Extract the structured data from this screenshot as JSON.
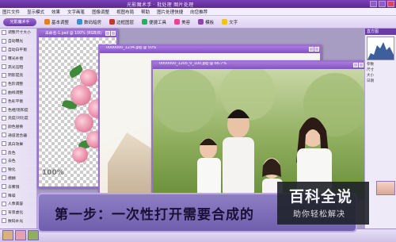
{
  "window": {
    "title": "光影魔术手 · 批处理  图片处理"
  },
  "menubar": {
    "items": [
      "图片文件",
      "显示模式",
      "效果",
      "文字画笔",
      "图像调整",
      "视图布局",
      "帮助",
      "图片处理快捷",
      "向您推荐"
    ]
  },
  "toolbar": {
    "logo": "光影魔术手",
    "items": [
      "基本调整",
      "数码暗房",
      "边框图层",
      "便捷工具",
      "美容",
      "模板",
      "文字"
    ]
  },
  "sidebar": {
    "items": [
      "调整尺寸大小",
      "自动曝光",
      "自动白平衡",
      "曝光补偿",
      "高光压暗",
      "阴影提亮",
      "色阶调整",
      "曲线调整",
      "色彩平衡",
      "色相/饱和度",
      "亮度/对比度",
      "颜色替换",
      "通道混合器",
      "黑白效果",
      "反色",
      "去色",
      "锐化",
      "模糊",
      "去雾镜",
      "降噪",
      "人像美容",
      "背景虚化",
      "数码补光"
    ]
  },
  "right_panel": {
    "header": "直方图",
    "rows": [
      "参数",
      "尺寸",
      "大小",
      "日期"
    ]
  },
  "windows": [
    {
      "title": "未命名-1.psd @ 100% (RGB/8)",
      "zoom": "100%"
    },
    {
      "title": "0000000_1234.jpg @ 50%"
    },
    {
      "title": "0000000_1205_0_100.jpg @ 66.7%"
    }
  ],
  "banner": {
    "text": "第一步：一次性打开需要合成的"
  },
  "watermark": {
    "line1": "百科全说",
    "line2": "助你轻松解决"
  }
}
